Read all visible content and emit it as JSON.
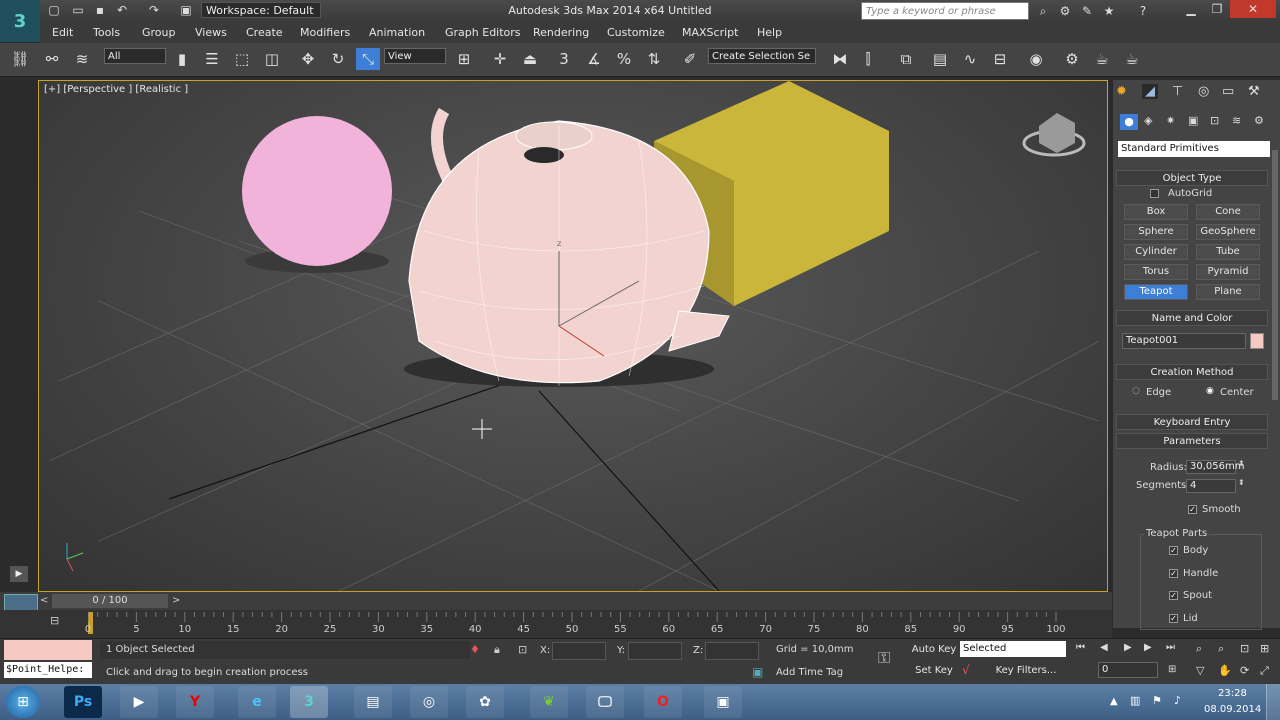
{
  "titlebar": {
    "workspace": "Workspace: Default",
    "app_title": "Autodesk 3ds Max  2014 x64      Untitled",
    "search_placeholder": "Type a keyword or phrase"
  },
  "menu": [
    "Edit",
    "Tools",
    "Group",
    "Views",
    "Create",
    "Modifiers",
    "Animation",
    "Graph Editors",
    "Rendering",
    "Customize",
    "MAXScript",
    "Help"
  ],
  "toolbar": {
    "filter_select": "All",
    "refcoord_select": "View",
    "snap_label": "3",
    "selection_set": "Create Selection Se"
  },
  "viewport": {
    "label": "[+] [Perspective ] [Realistic ]",
    "axis_z": "z"
  },
  "cmdpanel": {
    "category": "Standard Primitives",
    "object_type_header": "Object Type",
    "autogrid": "AutoGrid",
    "buttons": [
      "Box",
      "Cone",
      "Sphere",
      "GeoSphere",
      "Cylinder",
      "Tube",
      "Torus",
      "Pyramid",
      "Teapot",
      "Plane"
    ],
    "active_button": "Teapot",
    "name_color_header": "Name and Color",
    "object_name": "Teapot001",
    "object_color": "#f6c9c2",
    "creation_method_header": "Creation Method",
    "creation_edge": "Edge",
    "creation_center": "Center",
    "keyboard_entry_header": "Keyboard Entry",
    "parameters_header": "Parameters",
    "radius_label": "Radius:",
    "radius_value": "30,056mm",
    "segments_label": "Segments:",
    "segments_value": "4",
    "smooth_label": "Smooth",
    "teapot_parts_label": "Teapot Parts",
    "parts": [
      "Body",
      "Handle",
      "Spout",
      "Lid"
    ]
  },
  "timeline": {
    "frame_label": "0 / 100",
    "ticks": [
      "0",
      "5",
      "10",
      "15",
      "20",
      "25",
      "30",
      "35",
      "40",
      "45",
      "50",
      "55",
      "60",
      "65",
      "70",
      "75",
      "80",
      "85",
      "90",
      "95",
      "100"
    ]
  },
  "status": {
    "script_field": "$Point_Helpe:",
    "selected_text": "1 Object Selected",
    "prompt_text": "Click and drag to begin creation process",
    "x_label": "X:",
    "y_label": "Y:",
    "z_label": "Z:",
    "grid_text": "Grid = 10,0mm",
    "add_time_tag": "Add Time Tag",
    "auto_key": "Auto Key",
    "auto_key_select": "Selected",
    "set_key": "Set Key",
    "key_filters": "Key Filters...",
    "frame_input": "0"
  },
  "taskbar": {
    "time": "23:28",
    "date": "08.09.2014"
  },
  "colors": {
    "accent_yellow": "#c9a12a",
    "teapot": "#f3d3cf",
    "sphere": "#f2b3da",
    "box": "#c9b63a",
    "active_blue": "#3d7fd6"
  }
}
